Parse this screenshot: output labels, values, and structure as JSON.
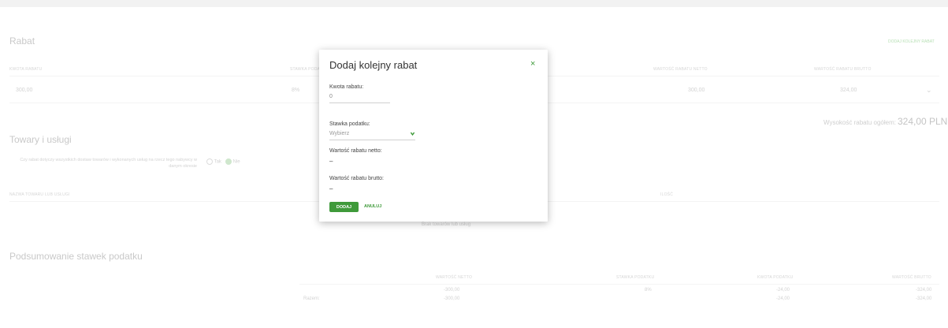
{
  "rabat": {
    "title": "Rabat",
    "add_link": "DODAJ KOLEJNY RABAT",
    "headers": [
      "KWOTA RABATU",
      "STAWKA PODATKU",
      "WARTOŚĆ RABATU NETTO",
      "WARTOŚĆ RABATU BRUTTO"
    ],
    "row": {
      "kwota": "300,00",
      "stawka": "8%",
      "netto": "300,00",
      "brutto": "324,00"
    },
    "total_label": "Wysokość rabatu ogółem:",
    "total_value": "324,00 PLN"
  },
  "towary": {
    "title": "Towary i usługi",
    "question": "Czy rabat dotyczy wszystkich dostaw towarów i wykonanych usług na rzecz tego nabywcy w danym okresie",
    "option_yes": "Tak",
    "option_no": "Nie",
    "col_left": "NAZWA TOWARU LUB USŁUGI",
    "col_right": "ILOŚĆ",
    "empty": "Brak towarów lub usług"
  },
  "podsumowanie": {
    "title": "Podsumowanie stawek podatku",
    "headers": [
      "WARTOŚĆ NETTO",
      "STAWKA PODATKU",
      "KWOTA PODATKU",
      "WARTOŚĆ BRUTTO"
    ],
    "rows": [
      {
        "label": "",
        "netto": "-300,00",
        "stawka": "8%",
        "kwota": "-24,00",
        "brutto": "-324,00"
      },
      {
        "label": "Razem:",
        "netto": "-300,00",
        "stawka": "",
        "kwota": "-24,00",
        "brutto": "-324,00"
      }
    ]
  },
  "modal": {
    "title": "Dodaj kolejny rabat",
    "close": "×",
    "kwota_label": "Kwota rabatu:",
    "kwota_value": "0",
    "stawka_label": "Stawka podatku:",
    "stawka_placeholder": "Wybierz",
    "netto_label": "Wartość rabatu netto:",
    "netto_value": "–",
    "brutto_label": "Wartość rabatu brutto:",
    "brutto_value": "–",
    "add_button": "DODAJ",
    "cancel_button": "ANULUJ"
  },
  "colors": {
    "accent": "#3f9a3a"
  }
}
